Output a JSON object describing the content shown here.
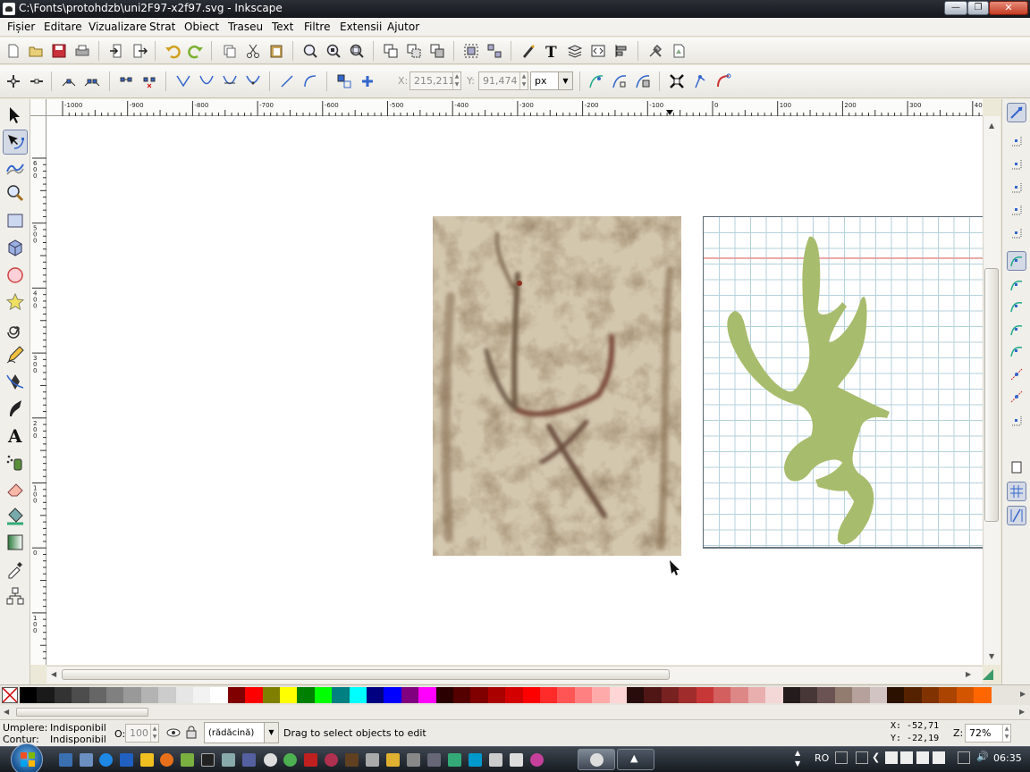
{
  "window": {
    "title": "C:\\Fonts\\protohdzb\\uni2F97-x2f97.svg - Inkscape",
    "minimize": "—",
    "maximize": "❐",
    "close": "✕"
  },
  "menu": [
    "Fișier",
    "Editare",
    "Vizualizare",
    "Strat",
    "Obiect",
    "Traseu",
    "Text",
    "Filtre",
    "Extensii",
    "Ajutor"
  ],
  "command_bar": {
    "icons": [
      "new-icon",
      "open-icon",
      "save-icon",
      "print-icon",
      "import-icon",
      "export-icon",
      "undo-icon",
      "redo-icon",
      "copy-icon",
      "cut-icon",
      "paste-icon",
      "zoom-selection-icon",
      "zoom-drawing-icon",
      "zoom-page-icon",
      "duplicate-icon",
      "clone-icon",
      "unlink-clone-icon",
      "group-icon",
      "ungroup-icon",
      "fill-stroke-icon",
      "text-font-icon",
      "layers-icon",
      "xml-editor-icon",
      "align-distribute-icon",
      "preferences-icon",
      "document-properties-icon"
    ]
  },
  "node_toolbar": {
    "x_label": "X:",
    "x_value": "215,211",
    "y_label": "Y:",
    "y_value": "91,474",
    "unit": "px",
    "icons": [
      "insert-node-icon",
      "delete-node-icon",
      "join-nodes-icon",
      "break-path-icon",
      "join-segment-icon",
      "delete-segment-icon",
      "cusp-node-icon",
      "smooth-node-icon",
      "symmetric-node-icon",
      "auto-smooth-node-icon",
      "line-segment-icon",
      "curve-segment-icon",
      "object-to-path-icon",
      "stroke-to-path-icon",
      "path-effect-icon",
      "clip-path-icon",
      "mask-icon",
      "show-transform-handles-icon",
      "show-handles-icon",
      "show-outline-icon"
    ]
  },
  "tools": [
    "selector-tool",
    "node-tool",
    "tweak-tool",
    "zoom-tool",
    "rectangle-tool",
    "3d-box-tool",
    "ellipse-tool",
    "star-tool",
    "spiral-tool",
    "pencil-tool",
    "pen-tool",
    "calligraphy-tool",
    "text-tool",
    "spray-tool",
    "eraser-tool",
    "paint-bucket-tool",
    "gradient-tool",
    "dropper-tool",
    "connector-tool"
  ],
  "ruler": {
    "h_labels": [
      "-1000",
      "-900",
      "-800",
      "-700",
      "-600",
      "-500",
      "-400",
      "-300",
      "-200",
      "-100",
      "0",
      "100",
      "200",
      "300",
      "400"
    ],
    "v_labels": [
      "600",
      "500",
      "400",
      "300",
      "200",
      "100",
      "0",
      "100"
    ]
  },
  "snap_icons": [
    "snap-toggle-icon",
    "snap-bbox-icon",
    "snap-bbox-edge-icon",
    "snap-bbox-corner-icon",
    "snap-bbox-edge-mid-icon",
    "snap-bbox-center-icon",
    "snap-nodes-icon",
    "snap-paths-icon",
    "snap-intersections-icon",
    "snap-cusp-nodes-icon",
    "snap-smooth-nodes-icon",
    "snap-line-midpoints-icon",
    "snap-object-midpoints-icon",
    "snap-rotation-center-icon",
    "snap-page-border-icon",
    "snap-grid-icon",
    "snap-guide-icon"
  ],
  "palette": [
    "#000000",
    "#1a1a1a",
    "#333333",
    "#4d4d4d",
    "#666666",
    "#808080",
    "#999999",
    "#b3b3b3",
    "#cccccc",
    "#e6e6e6",
    "#f2f2f2",
    "#ffffff",
    "#800000",
    "#ff0000",
    "#808000",
    "#ffff00",
    "#008000",
    "#00ff00",
    "#008080",
    "#00ffff",
    "#000080",
    "#0000ff",
    "#800080",
    "#ff00ff",
    "#2b0000",
    "#550000",
    "#800000",
    "#aa0000",
    "#d40000",
    "#ff0000",
    "#ff2a2a",
    "#ff5555",
    "#ff8080",
    "#ffaaaa",
    "#ffd5d5",
    "#280b0b",
    "#501616",
    "#782121",
    "#a02c2c",
    "#c83737",
    "#d35f5f",
    "#de8787",
    "#e9afaf",
    "#f4d7d7",
    "#241c1c",
    "#483737",
    "#6c5353",
    "#917c6f",
    "#b7a19d",
    "#d3c4c4",
    "#2b1100",
    "#552200",
    "#803300",
    "#aa4400",
    "#d45500",
    "#ff6600"
  ],
  "status": {
    "fill_label": "Umplere:",
    "fill_value": "Indisponibil",
    "stroke_label": "Contur:",
    "stroke_value": "Indisponibil",
    "opacity_label": "O:",
    "opacity_value": "100",
    "layer": "(rădăcină)",
    "message": "Drag to select objects to edit",
    "x_coord": "X:  -52,71",
    "y_coord": "Y:  -22,19",
    "zoom_label": "Z:",
    "zoom_value": "72%"
  },
  "taskbar": {
    "lang": "RO",
    "time": "06:35"
  }
}
